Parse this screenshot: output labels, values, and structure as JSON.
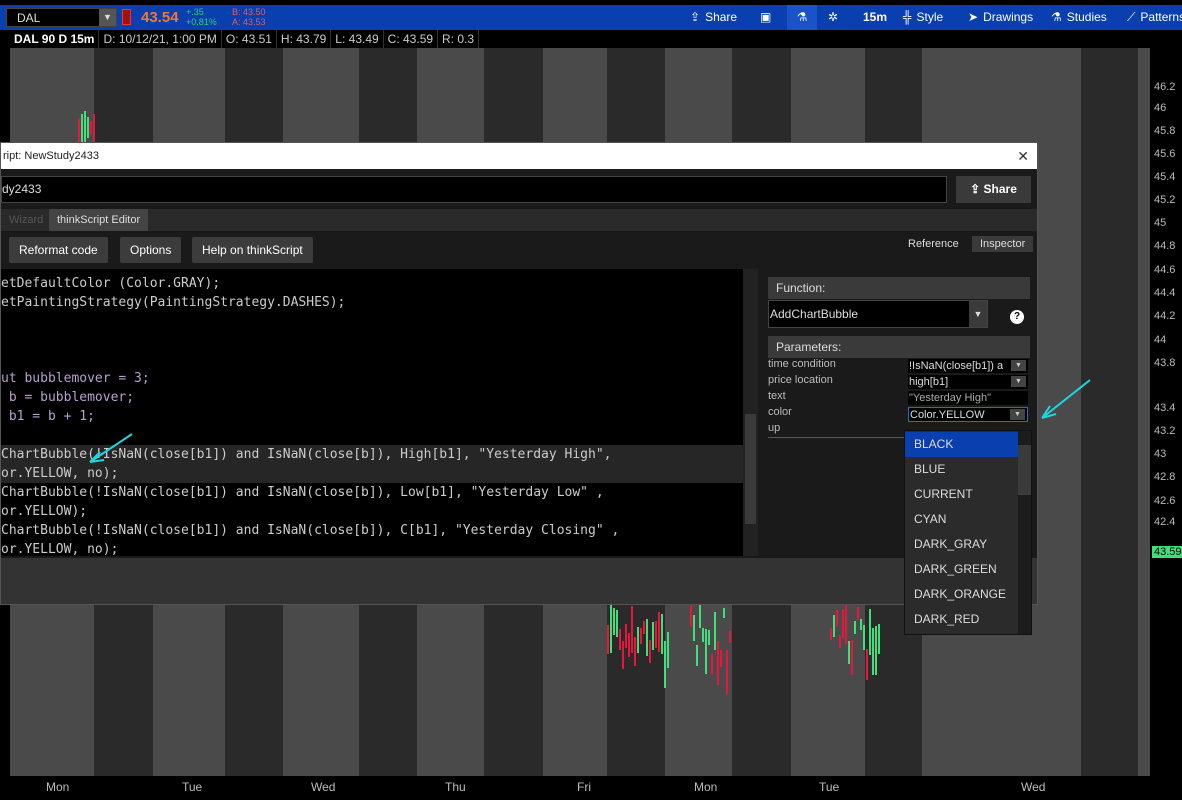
{
  "topbar": {
    "symbol": "DAL",
    "last": "43.54",
    "change": "+.35",
    "change_pct": "+0.81%",
    "bid": "B: 43.50",
    "ask": "A: 43.53",
    "share": "Share",
    "timeframe": "15m",
    "style": "Style",
    "drawings": "Drawings",
    "studies": "Studies",
    "patterns": "Patterns"
  },
  "infobar": [
    "DAL 90 D 15m",
    "D: 10/12/21, 1:00 PM",
    "O: 43.51",
    "H: 43.79",
    "L: 43.49",
    "C: 43.59",
    "R: 0.3"
  ],
  "yaxis": [
    "46.2",
    "46",
    "45.8",
    "45.6",
    "45.4",
    "45.2",
    "45",
    "44.8",
    "44.6",
    "44.4",
    "44.2",
    "44",
    "43.8",
    "43.4",
    "43.2",
    "43",
    "42.8",
    "42.6",
    "42.4"
  ],
  "current_price": "43.59",
  "xaxis": [
    "Mon",
    "Tue",
    "Wed",
    "Thu",
    "Fri",
    "Mon",
    "Tue",
    "Wed"
  ],
  "dialog": {
    "title": "ript: NewStudy2433",
    "name": "dy2433",
    "share": "Share",
    "tabs": [
      "Wizard",
      "thinkScript Editor"
    ],
    "buttons": [
      "Reformat code",
      "Options",
      "Help on thinkScript"
    ],
    "reference": "Reference",
    "inspector": "Inspector",
    "function_label": "Function:",
    "function_value": "AddChartBubble",
    "parameters_label": "Parameters:",
    "params": [
      {
        "name": "time condition",
        "value": "!IsNaN(close[b1]) a"
      },
      {
        "name": "price location",
        "value": "high[b1]"
      },
      {
        "name": "text",
        "value": "\"Yesterday High\""
      },
      {
        "name": "color",
        "value": "Color.YELLOW"
      },
      {
        "name": "up",
        "value": ""
      }
    ],
    "color_options": [
      "BLACK",
      "BLUE",
      "CURRENT",
      "CYAN",
      "DARK_GRAY",
      "DARK_GREEN",
      "DARK_ORANGE",
      "DARK_RED"
    ]
  },
  "code": [
    "etDefaultColor (Color.GRAY);",
    "etPaintingStrategy(PaintingStrategy.DASHES);",
    "ut bubblemover = 3;",
    " b = bubblemover;",
    " b1 = b + 1;",
    "ChartBubble(!IsNaN(close[b1]) and IsNaN(close[b]), High[b1], \"Yesterday High\",",
    "or.YELLOW, no);",
    "ChartBubble(!IsNaN(close[b1]) and IsNaN(close[b]), Low[b1], \"Yesterday Low\" ,",
    "or.YELLOW);",
    "ChartBubble(!IsNaN(close[b1]) and IsNaN(close[b]), C[b1], \"Yesterday Closing\" ,",
    "or.YELLOW, no);"
  ],
  "colors": {
    "accent": "#0a3fb0",
    "up": "#3fe07a",
    "down": "#e8163c",
    "annotation": "#1ed6e0"
  }
}
